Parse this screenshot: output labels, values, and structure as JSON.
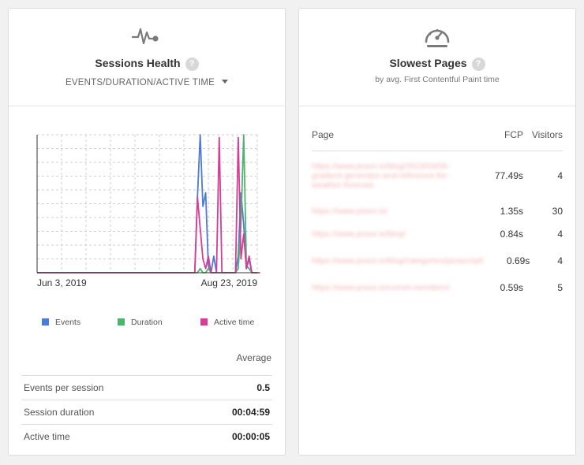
{
  "sessions": {
    "title": "Sessions Health",
    "help": "?",
    "metric_select": "EVENTS/DURATION/ACTIVE TIME",
    "icon": "pulse-icon"
  },
  "chart_data": {
    "type": "line",
    "x_start": "2019-06-03",
    "x_end": "2019-08-23",
    "x_tick_labels": [
      "Jun 3, 2019",
      "Aug 23, 2019"
    ],
    "ylim": [
      0,
      1
    ],
    "grid": true,
    "legend_position": "bottom",
    "series": [
      {
        "name": "Events",
        "color": "#4f7ad6",
        "points": [
          [
            0,
            0
          ],
          [
            58,
            0
          ],
          [
            59,
            0.55
          ],
          [
            60,
            1.0
          ],
          [
            61,
            0.48
          ],
          [
            62,
            0.58
          ],
          [
            63,
            0.05
          ],
          [
            64,
            0
          ],
          [
            65,
            0.12
          ],
          [
            66,
            0
          ],
          [
            73,
            0
          ],
          [
            74,
            0.12
          ],
          [
            75,
            0.58
          ],
          [
            76,
            0.35
          ],
          [
            77,
            0.03
          ],
          [
            78,
            0.1
          ],
          [
            79,
            0
          ],
          [
            82,
            0
          ]
        ]
      },
      {
        "name": "Duration",
        "color": "#4db36d",
        "points": [
          [
            0,
            0
          ],
          [
            59,
            0
          ],
          [
            60,
            0.03
          ],
          [
            61,
            0
          ],
          [
            62,
            0
          ],
          [
            63,
            0.03
          ],
          [
            64,
            0
          ],
          [
            73,
            0
          ],
          [
            74,
            0.03
          ],
          [
            75,
            0.35
          ],
          [
            76,
            1.0
          ],
          [
            77,
            0.05
          ],
          [
            78,
            0.03
          ],
          [
            79,
            0
          ],
          [
            82,
            0
          ]
        ]
      },
      {
        "name": "Active time",
        "color": "#d63d97",
        "points": [
          [
            0,
            0
          ],
          [
            58,
            0
          ],
          [
            59,
            0.55
          ],
          [
            60,
            0.32
          ],
          [
            61,
            0.1
          ],
          [
            62,
            0.03
          ],
          [
            63,
            0.12
          ],
          [
            64,
            0
          ],
          [
            66,
            0
          ],
          [
            67,
            0.98
          ],
          [
            68,
            0
          ],
          [
            73,
            0
          ],
          [
            74,
            0.98
          ],
          [
            75,
            0.1
          ],
          [
            76,
            0.28
          ],
          [
            77,
            0.03
          ],
          [
            78,
            0.12
          ],
          [
            79,
            0
          ],
          [
            82,
            0
          ]
        ]
      }
    ]
  },
  "stats": {
    "header": "Average",
    "rows": [
      {
        "label": "Events per session",
        "value": "0.5"
      },
      {
        "label": "Session duration",
        "value": "00:04:59"
      },
      {
        "label": "Active time",
        "value": "00:00:05"
      }
    ]
  },
  "slow_pages": {
    "title": "Slowest Pages",
    "help": "?",
    "subtitle": "by avg. First Contentful Paint time",
    "icon": "speedometer-icon",
    "columns": [
      "Page",
      "FCP",
      "Visitors"
    ],
    "rows": [
      {
        "page": "https://www.posor.io/blog/2019/03/06-gradient-generator-and-reference-for-weather-forecast",
        "fcp": "77.49s",
        "visitors": "4"
      },
      {
        "page": "https://www.posor.io/",
        "fcp": "1.35s",
        "visitors": "30"
      },
      {
        "page": "https://www.posor.io/blog/",
        "fcp": "0.84s",
        "visitors": "4"
      },
      {
        "page": "https://www.posor.io/blog/categories/javascript/",
        "fcp": "0.69s",
        "visitors": "4"
      },
      {
        "page": "https://www.posor.io/comet-members/",
        "fcp": "0.59s",
        "visitors": "5"
      }
    ]
  }
}
